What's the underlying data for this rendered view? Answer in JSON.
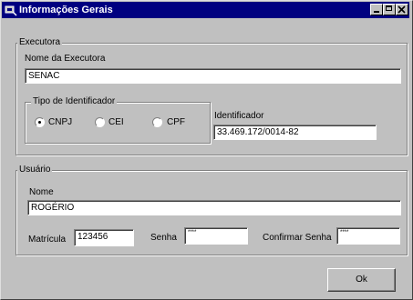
{
  "window": {
    "title": "Informações Gerais"
  },
  "executora": {
    "group_label": "Executora",
    "nome_label": "Nome da Executora",
    "nome_value": "SENAC",
    "tipo_label": "Tipo de Identificador",
    "tipo_options": [
      "CNPJ",
      "CEI",
      "CPF"
    ],
    "tipo_selected": "CNPJ",
    "identificador_label": "Identificador",
    "identificador_value": "33.469.172/0014-82"
  },
  "usuario": {
    "group_label": "Usuário",
    "nome_label": "Nome",
    "nome_value": "ROGÉRIO",
    "matricula_label": "Matrícula",
    "matricula_value": "123456",
    "senha_label": "Senha",
    "senha_value": "****",
    "confirmar_label": "Confirmar Senha",
    "confirmar_value": "****"
  },
  "buttons": {
    "ok": "Ok"
  }
}
